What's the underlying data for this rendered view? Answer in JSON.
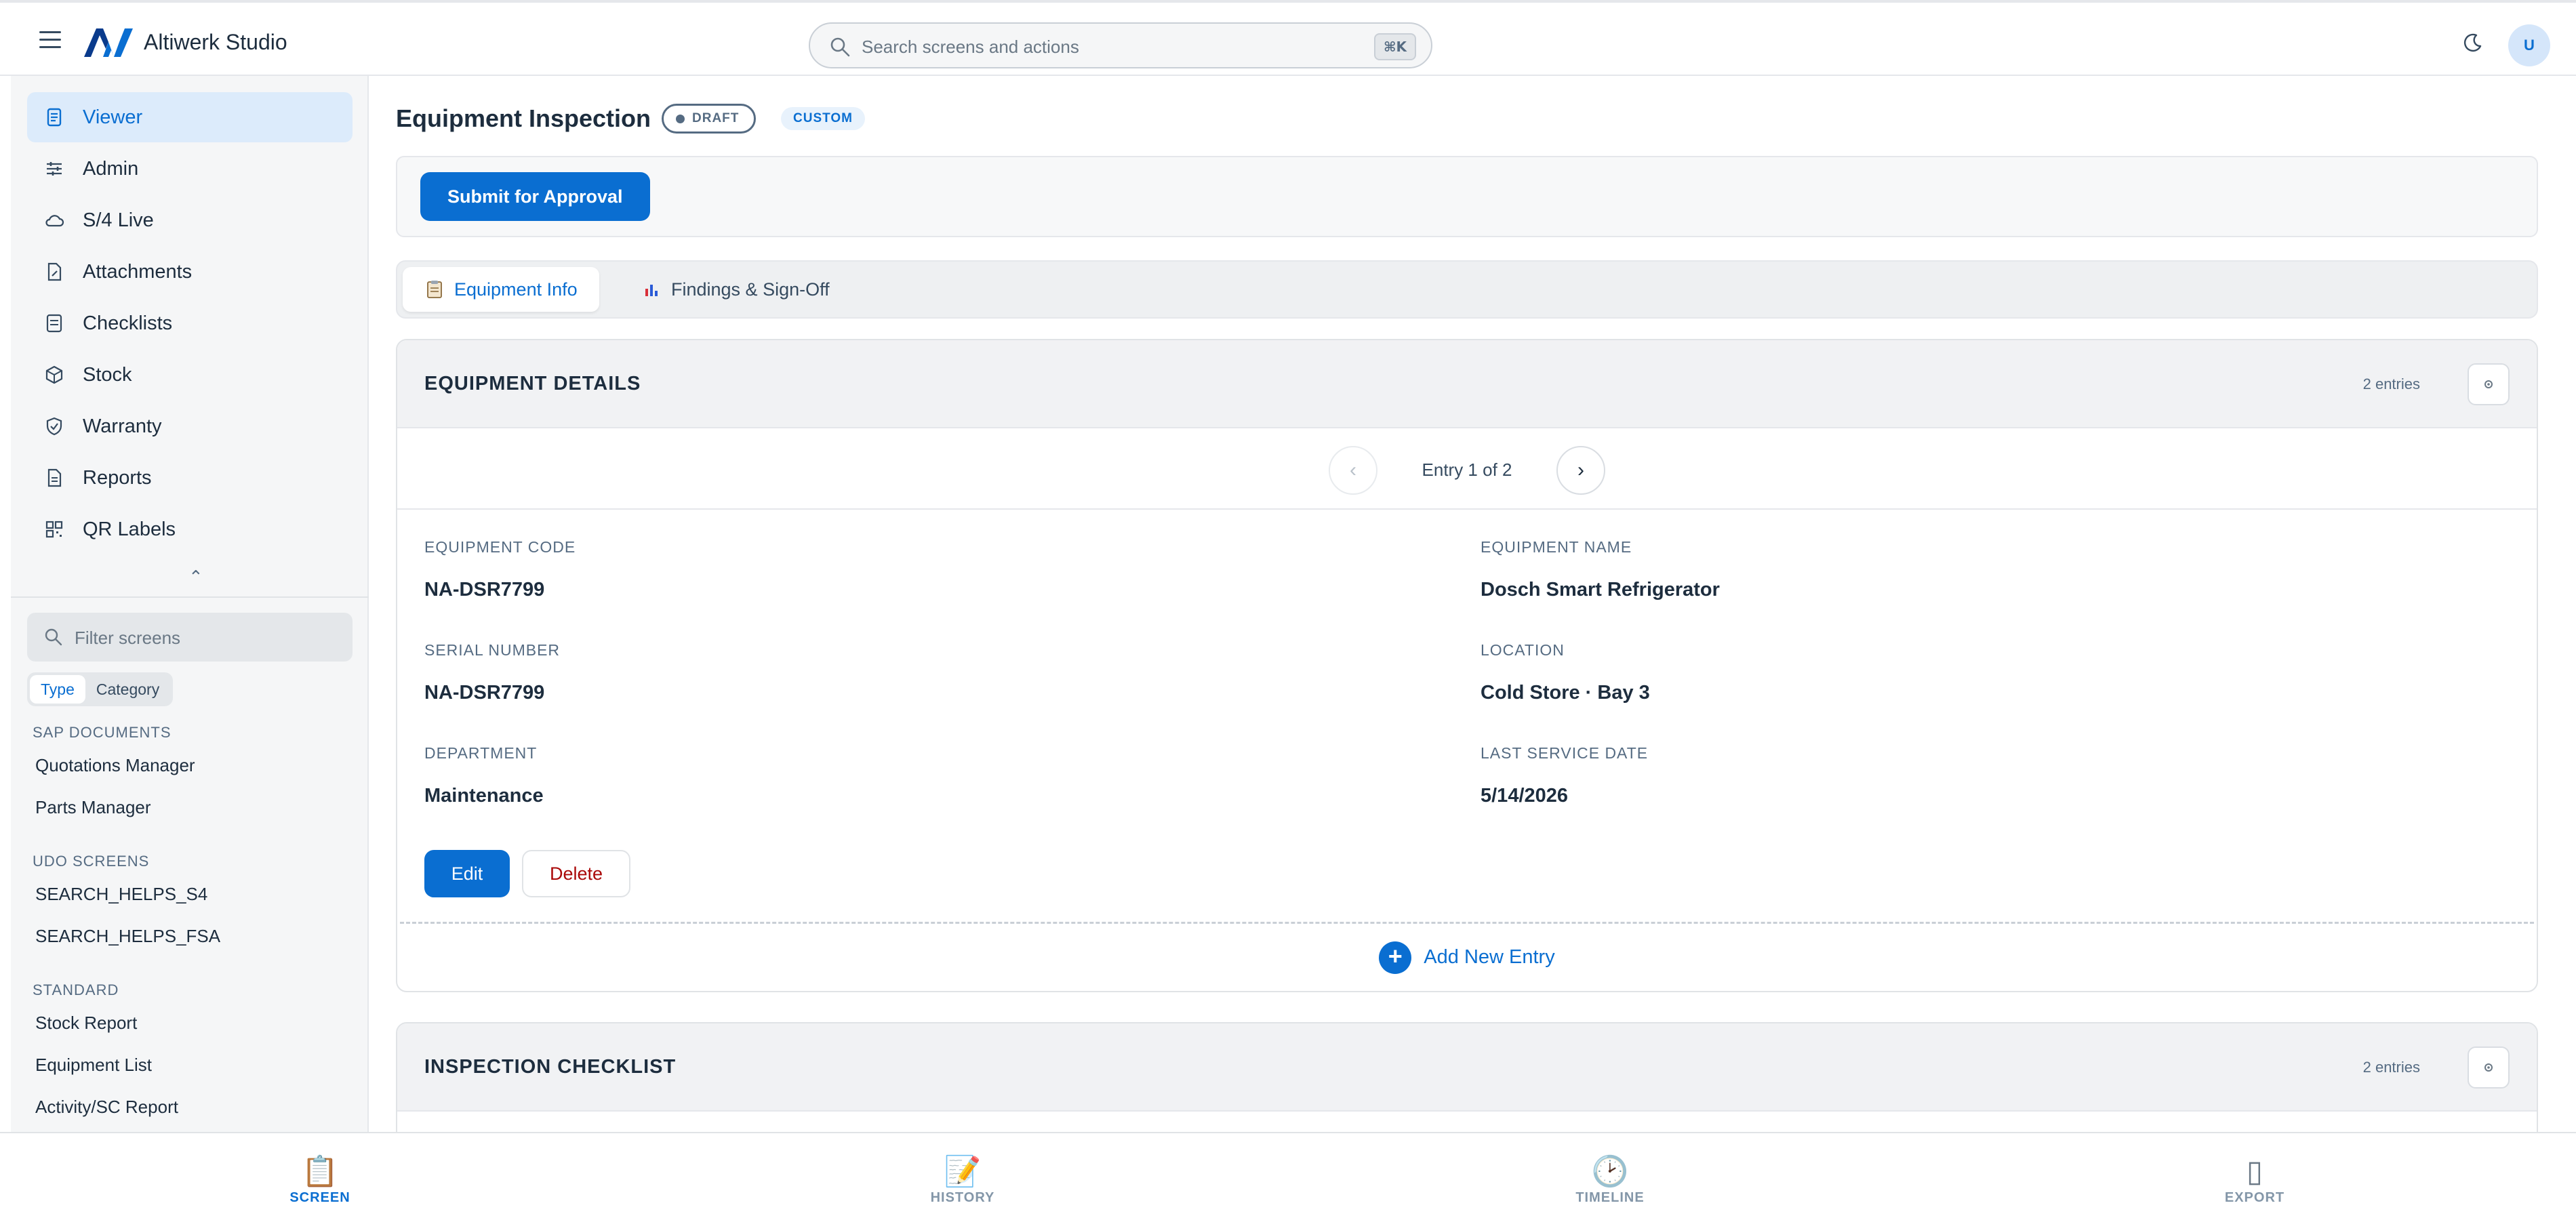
{
  "app": {
    "title": "Altiwerk Studio",
    "user_initial": "U",
    "search_placeholder": "Search screens and actions",
    "search_shortcut": "⌘K"
  },
  "sidebar": {
    "items": [
      {
        "label": "Viewer",
        "icon": "document-icon",
        "active": true
      },
      {
        "label": "Admin",
        "icon": "sliders-icon"
      },
      {
        "label": "S/4 Live",
        "icon": "cloud-icon"
      },
      {
        "label": "Attachments",
        "icon": "paperclip-document-icon"
      },
      {
        "label": "Checklists",
        "icon": "checklist-icon"
      },
      {
        "label": "Stock",
        "icon": "box-icon"
      },
      {
        "label": "Warranty",
        "icon": "shield-check-icon"
      },
      {
        "label": "Reports",
        "icon": "report-icon"
      },
      {
        "label": "QR Labels",
        "icon": "qr-code-icon"
      }
    ],
    "filter_placeholder": "Filter screens",
    "segment": [
      "Type",
      "Category"
    ],
    "groups": [
      {
        "heading": "SAP DOCUMENTS",
        "links": [
          "Quotations Manager",
          "Parts Manager"
        ]
      },
      {
        "heading": "UDO SCREENS",
        "links": [
          "SEARCH_HELPS_S4",
          "SEARCH_HELPS_FSA"
        ]
      },
      {
        "heading": "STANDARD",
        "links": [
          "Stock Report",
          "Equipment List",
          "Activity/SC Report"
        ]
      }
    ]
  },
  "page": {
    "title": "Equipment Inspection",
    "status_badge": "DRAFT",
    "type_badge": "CUSTOM",
    "submit_label": "Submit for Approval",
    "tabs": [
      {
        "label": "Equipment Info",
        "icon": "clipboard-emoji",
        "active": true
      },
      {
        "label": "Findings & Sign-Off",
        "icon": "bar-chart-emoji"
      }
    ]
  },
  "equipment_details": {
    "title": "EQUIPMENT DETAILS",
    "count": "2 entries",
    "pager": "Entry 1 of 2",
    "fields": [
      {
        "label": "EQUIPMENT CODE",
        "value": "NA-DSR7799"
      },
      {
        "label": "EQUIPMENT NAME",
        "value": "Dosch Smart Refrigerator"
      },
      {
        "label": "SERIAL NUMBER",
        "value": "NA-DSR7799"
      },
      {
        "label": "LOCATION",
        "value": "Cold Store · Bay 3"
      },
      {
        "label": "DEPARTMENT",
        "value": "Maintenance"
      },
      {
        "label": "LAST SERVICE DATE",
        "value": "5/14/2026"
      }
    ],
    "edit_label": "Edit",
    "delete_label": "Delete",
    "add_label": "Add New Entry"
  },
  "inspection_checklist": {
    "title": "INSPECTION CHECKLIST",
    "count": "2 entries"
  },
  "bottom_nav": [
    {
      "label": "SCREEN",
      "icon": "📋",
      "active": true
    },
    {
      "label": "HISTORY",
      "icon": "📝"
    },
    {
      "label": "TIMELINE",
      "icon": "🕑"
    },
    {
      "label": "EXPORT",
      "icon": "▯"
    }
  ],
  "colors": {
    "accent": "#0a6ed1",
    "danger": "#aa0808",
    "text": "#1d2d3e"
  }
}
